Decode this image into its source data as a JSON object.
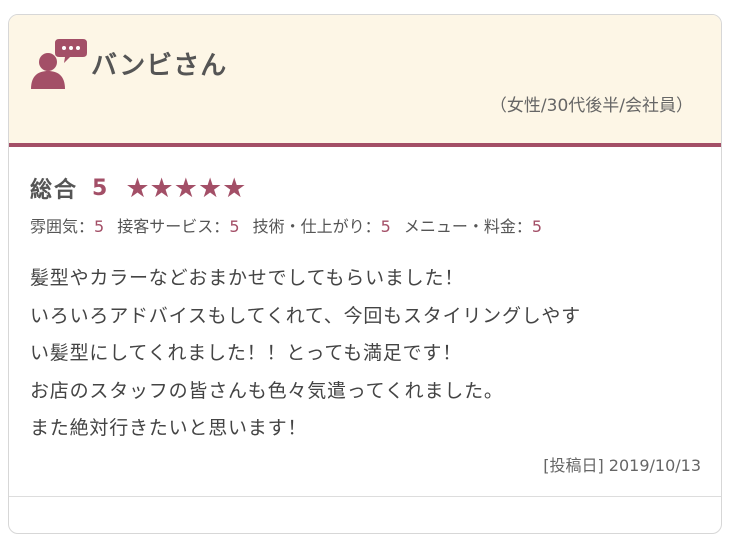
{
  "review": {
    "reviewer_name": "バンビさん",
    "reviewer_profile": "（女性/30代後半/会社員）",
    "overall_label": "総合",
    "overall_score": "5",
    "stars": "★★★★★",
    "star_rating": 5,
    "sub_ratings": [
      {
        "label": "雰囲気：",
        "value": "5"
      },
      {
        "label": "接客サービス：",
        "value": "5"
      },
      {
        "label": "技術・仕上がり：",
        "value": "5"
      },
      {
        "label": "メニュー・料金：",
        "value": "5"
      }
    ],
    "comment_lines": [
      "髪型やカラーなどおまかせでしてもらいました！",
      "いろいろアドバイスもしてくれて、今回もスタイリングしやす",
      "い髪型にしてくれました！！とっても満足です！",
      "お店のスタッフの皆さんも色々気遣ってくれました。",
      "また絶対行きたいと思います！"
    ],
    "posted_date": "[投稿日] 2019/10/13"
  },
  "colors": {
    "accent": "#a34f67",
    "header_bg": "#fdf6e6"
  },
  "icons": {
    "avatar": "user-chat-icon"
  }
}
